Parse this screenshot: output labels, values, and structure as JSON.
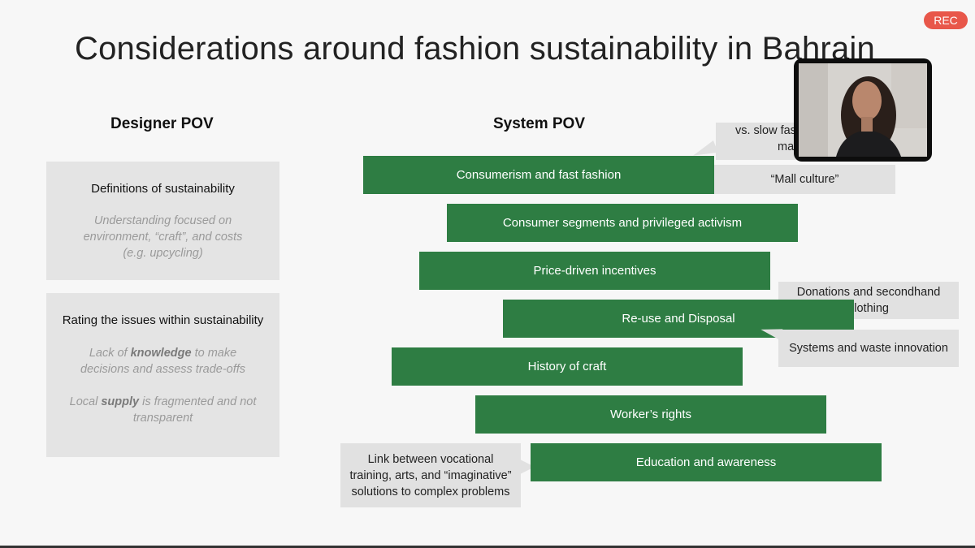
{
  "recording_badge": "REC",
  "slide": {
    "title": "Considerations around fashion sustainability in Bahrain",
    "designer_pov": {
      "heading": "Designer POV",
      "box1": {
        "heading": "Definitions of sustainability",
        "note_lines": [
          "Understanding focused on",
          "environment, “craft”, and costs",
          "(e.g. upcycling)"
        ]
      },
      "box2": {
        "heading": "Rating the issues within sustainability",
        "note1_pre": "Lack of ",
        "note1_bold": "knowledge",
        "note1_post": " to make",
        "note1_line2": "decisions and assess trade-offs",
        "note2_pre": "Local ",
        "note2_bold": "supply",
        "note2_post": " is fragmented and not",
        "note2_line2": "transparent"
      }
    },
    "system_pov": {
      "heading": "System POV",
      "bars": [
        "Consumerism and fast fashion",
        "Consumer segments and privileged activism",
        "Price-driven incentives",
        "Re-use and Disposal",
        "History of craft",
        "Worker’s rights",
        "Education and awareness"
      ],
      "callouts": {
        "slow_fashion": [
          "vs. slow fas",
          "mat"
        ],
        "mall_culture": "“Mall culture”",
        "donations": [
          "Donations and secondhand",
          "clothing"
        ],
        "systems_waste": "Systems and waste innovation",
        "vocational": [
          "Link between vocational",
          "training, arts, and “imaginative”",
          "solutions to complex problems"
        ]
      }
    }
  },
  "colors": {
    "bar_green": "#2e7d43",
    "callout_grey": "#e1e1e1",
    "rec_red": "#e8574a"
  },
  "webcam": {
    "icon": "participant-video-feed"
  }
}
